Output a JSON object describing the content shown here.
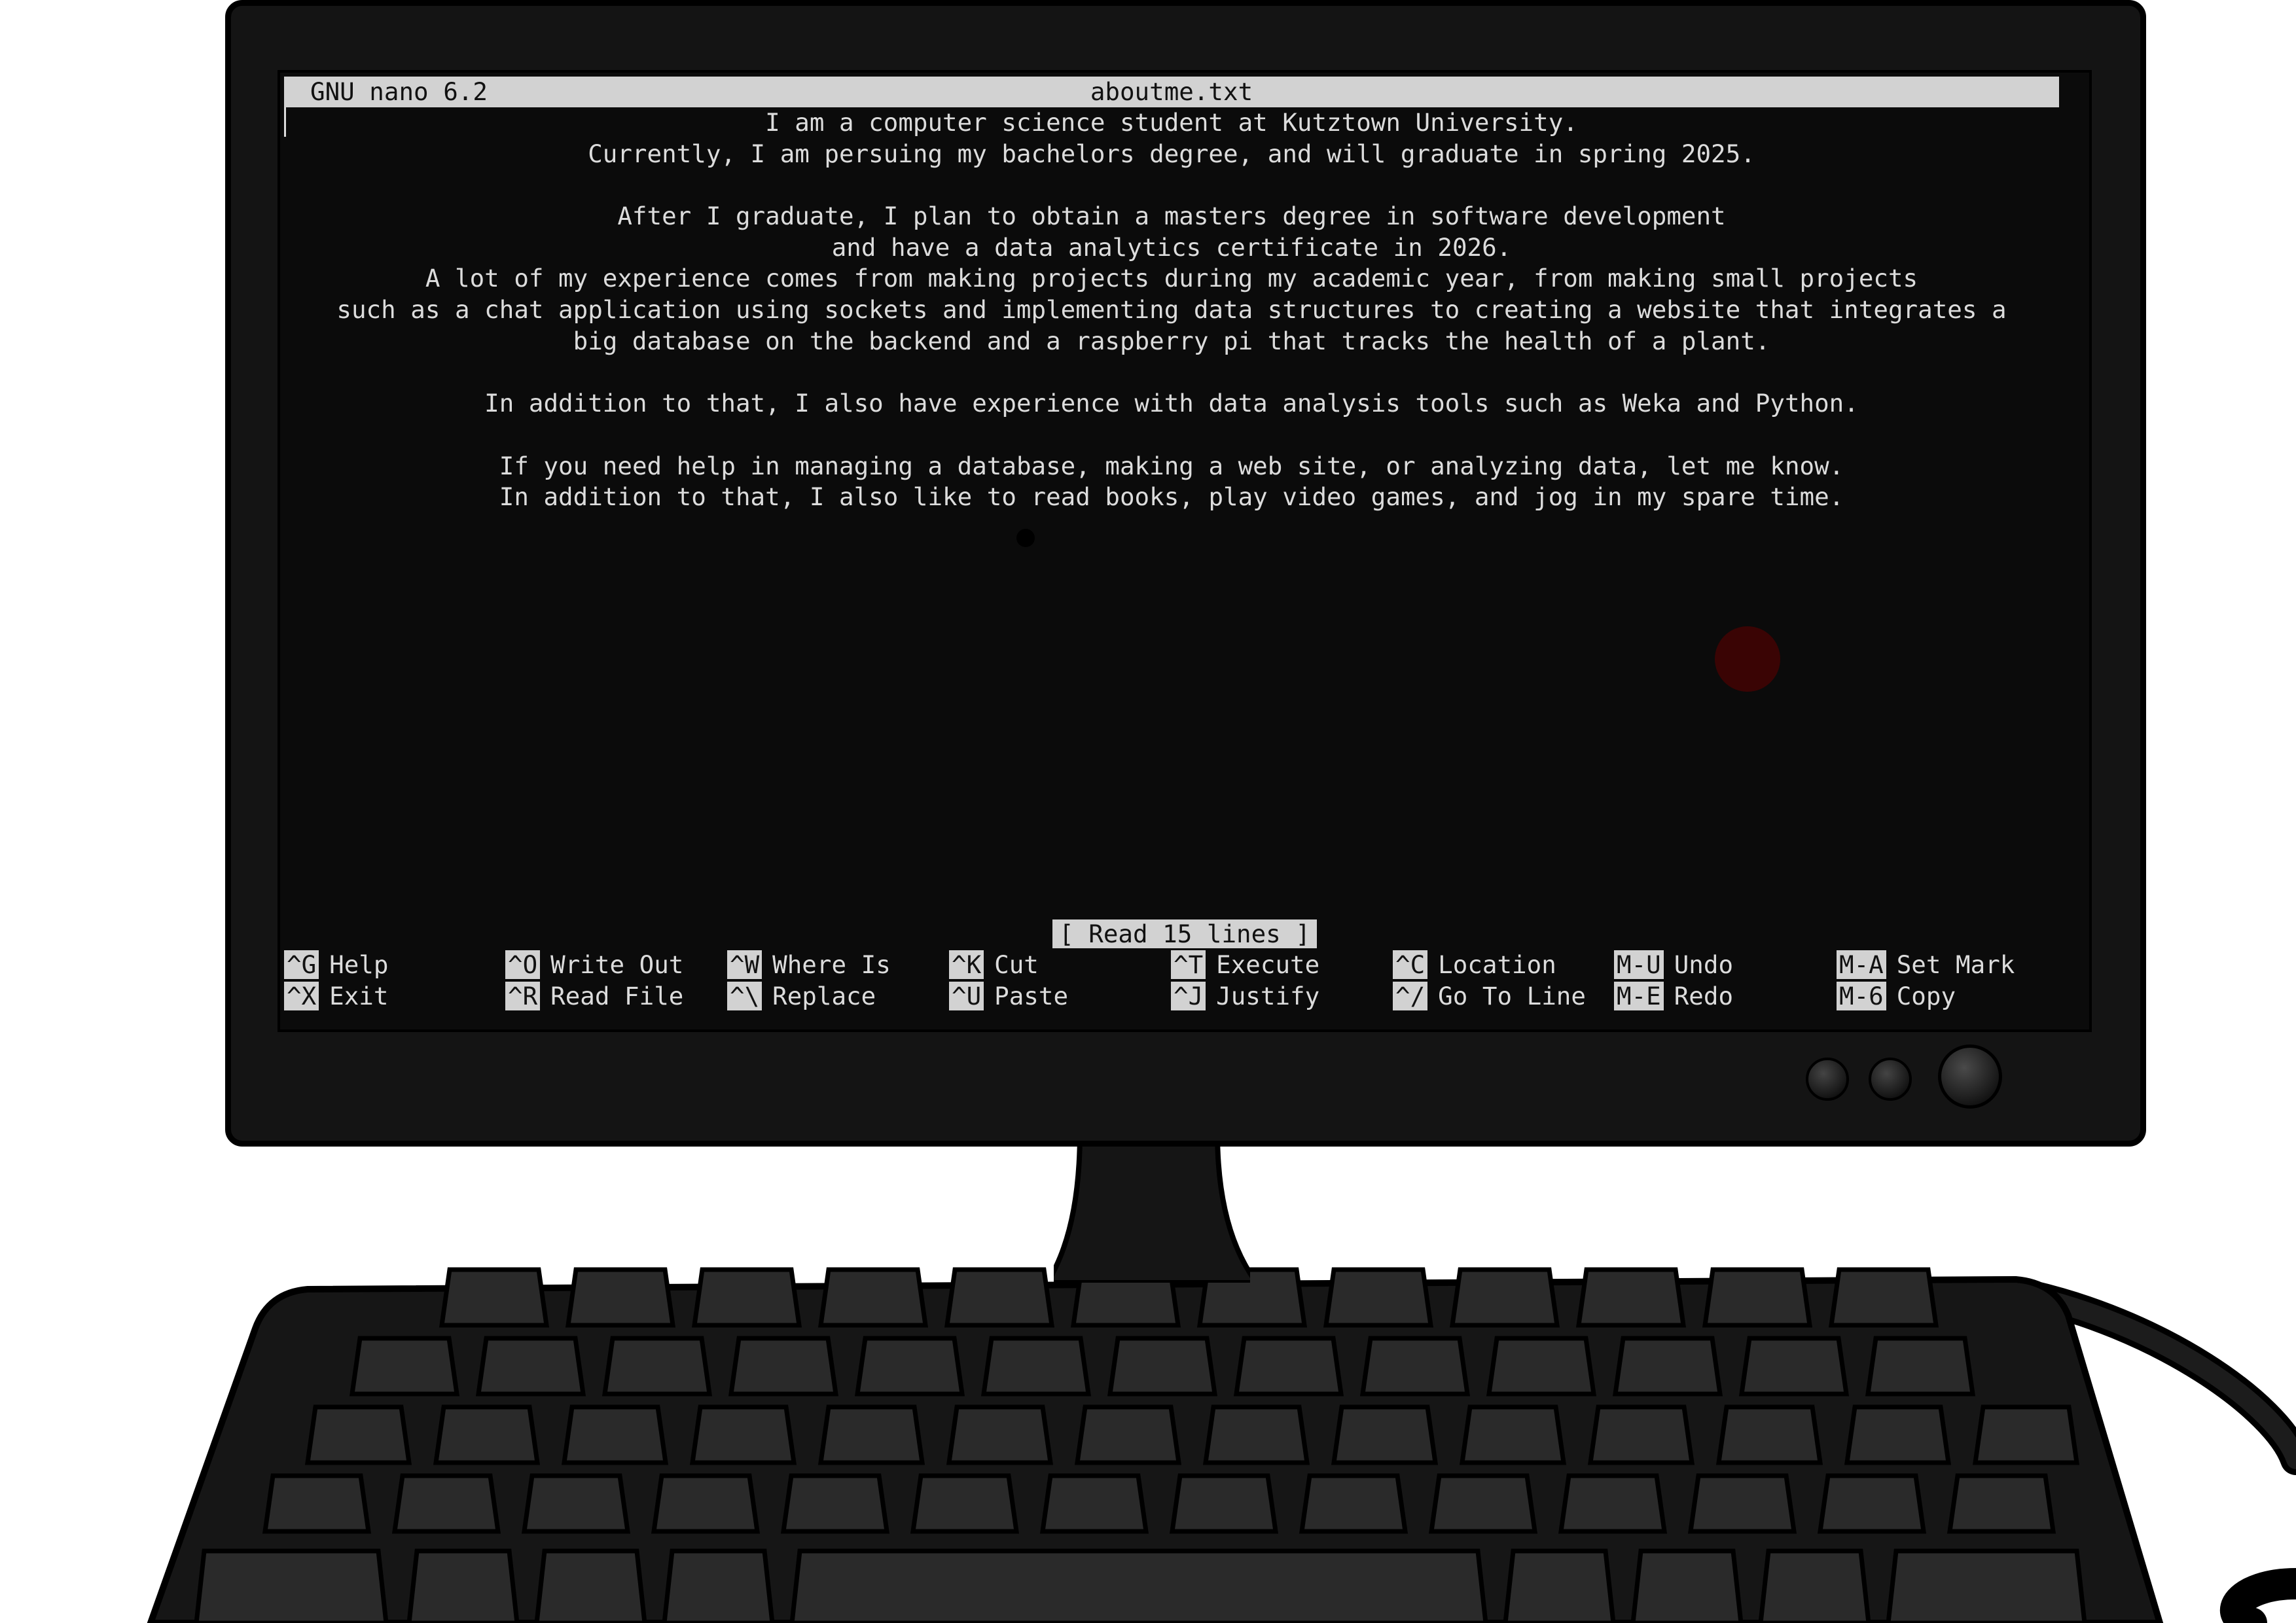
{
  "editor": {
    "app_name": "GNU nano 6.2",
    "file_name": "aboutme.txt",
    "lines": [
      "I am a computer science student at Kutztown University.",
      "Currently, I am persuing my bachelors degree, and will graduate in spring 2025.",
      "",
      "After I graduate, I plan to obtain a masters degree in software development",
      "and have a data analytics certificate in 2026.",
      "A lot of my experience comes from making projects during my academic year, from making small projects",
      "such as a chat application using sockets and implementing data structures to creating a website that integrates a",
      "big database on the backend and a raspberry pi that tracks the health of a plant.",
      "",
      "In addition to that, I also have experience with data analysis tools such as Weka and Python.",
      "",
      "If you need help in managing a database, making a web site, or analyzing data, let me know.",
      "In addition to that, I also like to read books, play video games, and jog in my spare time."
    ],
    "status_message": "[ Read 15 lines ]",
    "shortcuts": [
      {
        "key": "^G",
        "label": "Help"
      },
      {
        "key": "^O",
        "label": "Write Out"
      },
      {
        "key": "^W",
        "label": "Where Is"
      },
      {
        "key": "^K",
        "label": "Cut"
      },
      {
        "key": "^T",
        "label": "Execute"
      },
      {
        "key": "^C",
        "label": "Location"
      },
      {
        "key": "M-U",
        "label": "Undo"
      },
      {
        "key": "M-A",
        "label": "Set Mark"
      },
      {
        "key": "^X",
        "label": "Exit"
      },
      {
        "key": "^R",
        "label": "Read File"
      },
      {
        "key": "^\\",
        "label": "Replace"
      },
      {
        "key": "^U",
        "label": "Paste"
      },
      {
        "key": "^J",
        "label": "Justify"
      },
      {
        "key": "^/",
        "label": "Go To Line"
      },
      {
        "key": "M-E",
        "label": "Redo"
      },
      {
        "key": "M-6",
        "label": "Copy"
      }
    ]
  },
  "colors": {
    "terminal_background": "#0b0b0b",
    "terminal_text": "#dcdcdc",
    "highlight_bar": "#d2d2d2",
    "monitor_body": "#141414"
  }
}
